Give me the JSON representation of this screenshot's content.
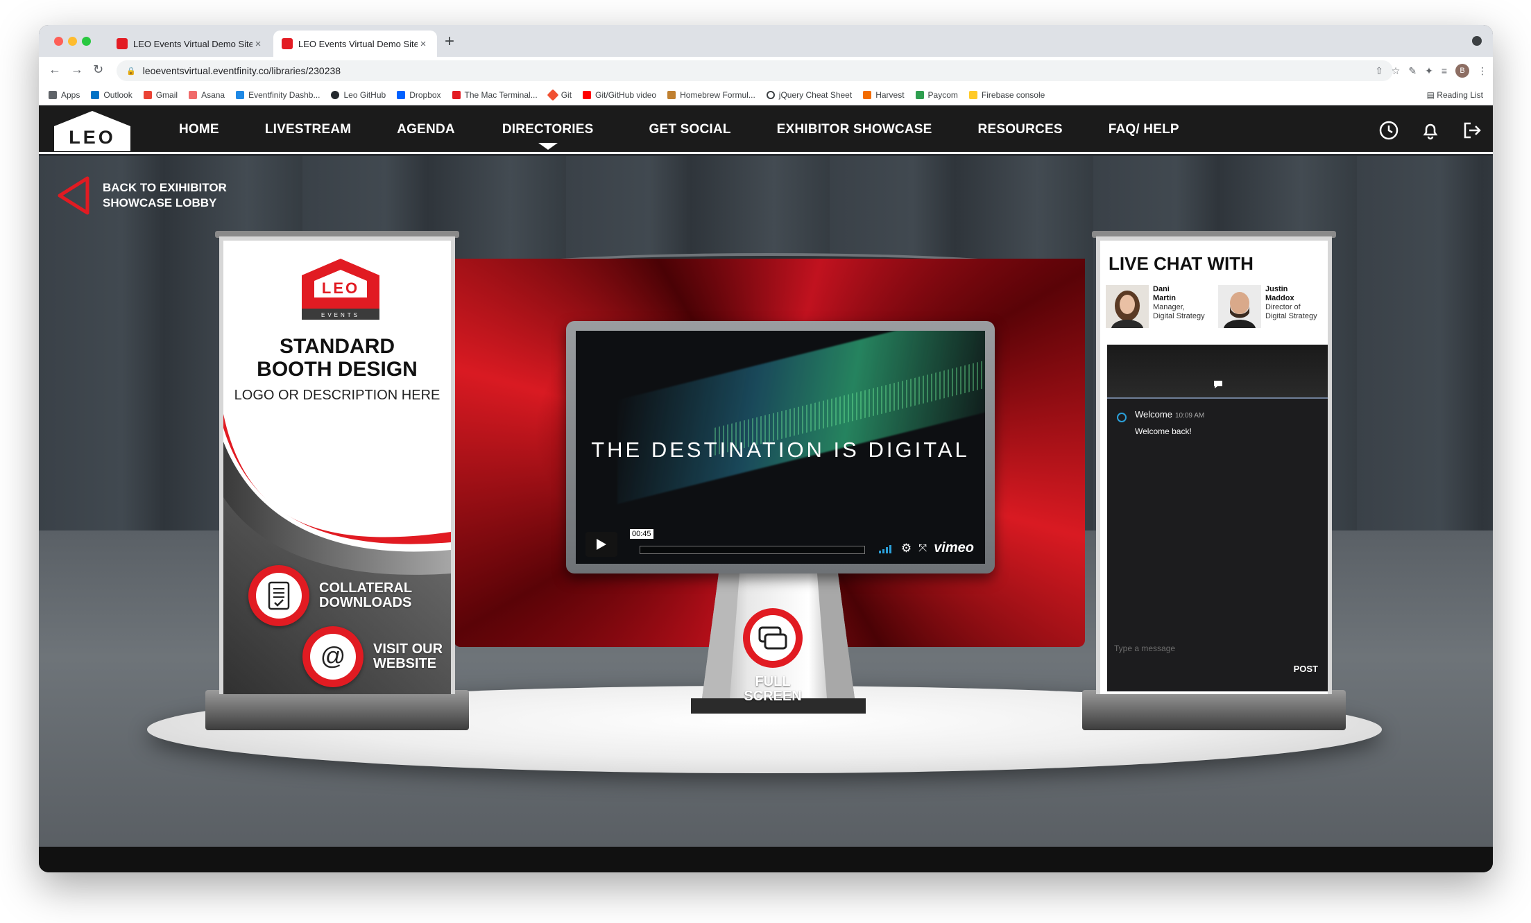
{
  "browser": {
    "tabs": [
      {
        "title": "LEO Events Virtual Demo Site",
        "active": false
      },
      {
        "title": "LEO Events Virtual Demo Site -",
        "active": true
      }
    ],
    "url": "leoeventsvirtual.eventfinity.co/libraries/230238",
    "profile_initial": "B",
    "bookmarks": [
      {
        "label": "Apps",
        "color": "#5f6368"
      },
      {
        "label": "Outlook",
        "color": "#0072c6"
      },
      {
        "label": "Gmail",
        "color": "#ea4335"
      },
      {
        "label": "Asana",
        "color": "#f06a6a"
      },
      {
        "label": "Eventfinity Dashb...",
        "color": "#1e88e5"
      },
      {
        "label": "Leo GitHub",
        "color": "#24292e"
      },
      {
        "label": "Dropbox",
        "color": "#0061ff"
      },
      {
        "label": "The Mac Terminal...",
        "color": "#e31b23"
      },
      {
        "label": "Git",
        "color": "#f05032"
      },
      {
        "label": "Git/GitHub video",
        "color": "#ff0000"
      },
      {
        "label": "Homebrew Formul...",
        "color": "#c08030"
      },
      {
        "label": "jQuery Cheat Sheet",
        "color": "#3c4043"
      },
      {
        "label": "Harvest",
        "color": "#f36c00"
      },
      {
        "label": "Paycom",
        "color": "#2e9e4f"
      },
      {
        "label": "Firebase console",
        "color": "#ffca28"
      }
    ],
    "reading_list": "Reading List"
  },
  "site": {
    "logo_text": "LEO",
    "menu": [
      "HOME",
      "LIVESTREAM",
      "AGENDA",
      "DIRECTORIES",
      "GET SOCIAL",
      "EXHIBITOR SHOWCASE",
      "RESOURCES",
      "FAQ/ HELP"
    ],
    "active_menu": "DIRECTORIES",
    "icons": [
      "clock-icon",
      "bell-icon",
      "logout-icon"
    ]
  },
  "booth": {
    "back_link": "BACK TO EXIHIBITOR SHOWCASE LOBBY",
    "banner": {
      "logo_text": "LEO",
      "logo_sub": "EVENTS",
      "title_line1": "STANDARD",
      "title_line2": "BOOTH DESIGN",
      "subtitle": "LOGO OR DESCRIPTION HERE",
      "collateral_line1": "COLLATERAL",
      "collateral_line2": "DOWNLOADS",
      "website_line1": "VISIT OUR",
      "website_line2": "WEBSITE"
    },
    "video": {
      "title": "THE DESTINATION IS DIGITAL",
      "time": "00:45",
      "brand": "vimeo"
    },
    "fullscreen_line1": "FULL",
    "fullscreen_line2": "SCREEN",
    "chat": {
      "title": "LIVE CHAT WITH",
      "people": [
        {
          "first": "Dani",
          "last": "Martin",
          "title_line1": "Manager,",
          "title_line2": "Digital Strategy"
        },
        {
          "first": "Justin",
          "last": "Maddox",
          "title_line1": "Director of",
          "title_line2": "Digital Strategy"
        }
      ],
      "message": {
        "name": "Welcome",
        "time": "10:09 AM",
        "text": "Welcome back!"
      },
      "input_placeholder": "Type a message",
      "post_label": "POST"
    }
  },
  "colors": {
    "brand_red": "#e11b22",
    "nav_bg": "#1b1b1b"
  }
}
